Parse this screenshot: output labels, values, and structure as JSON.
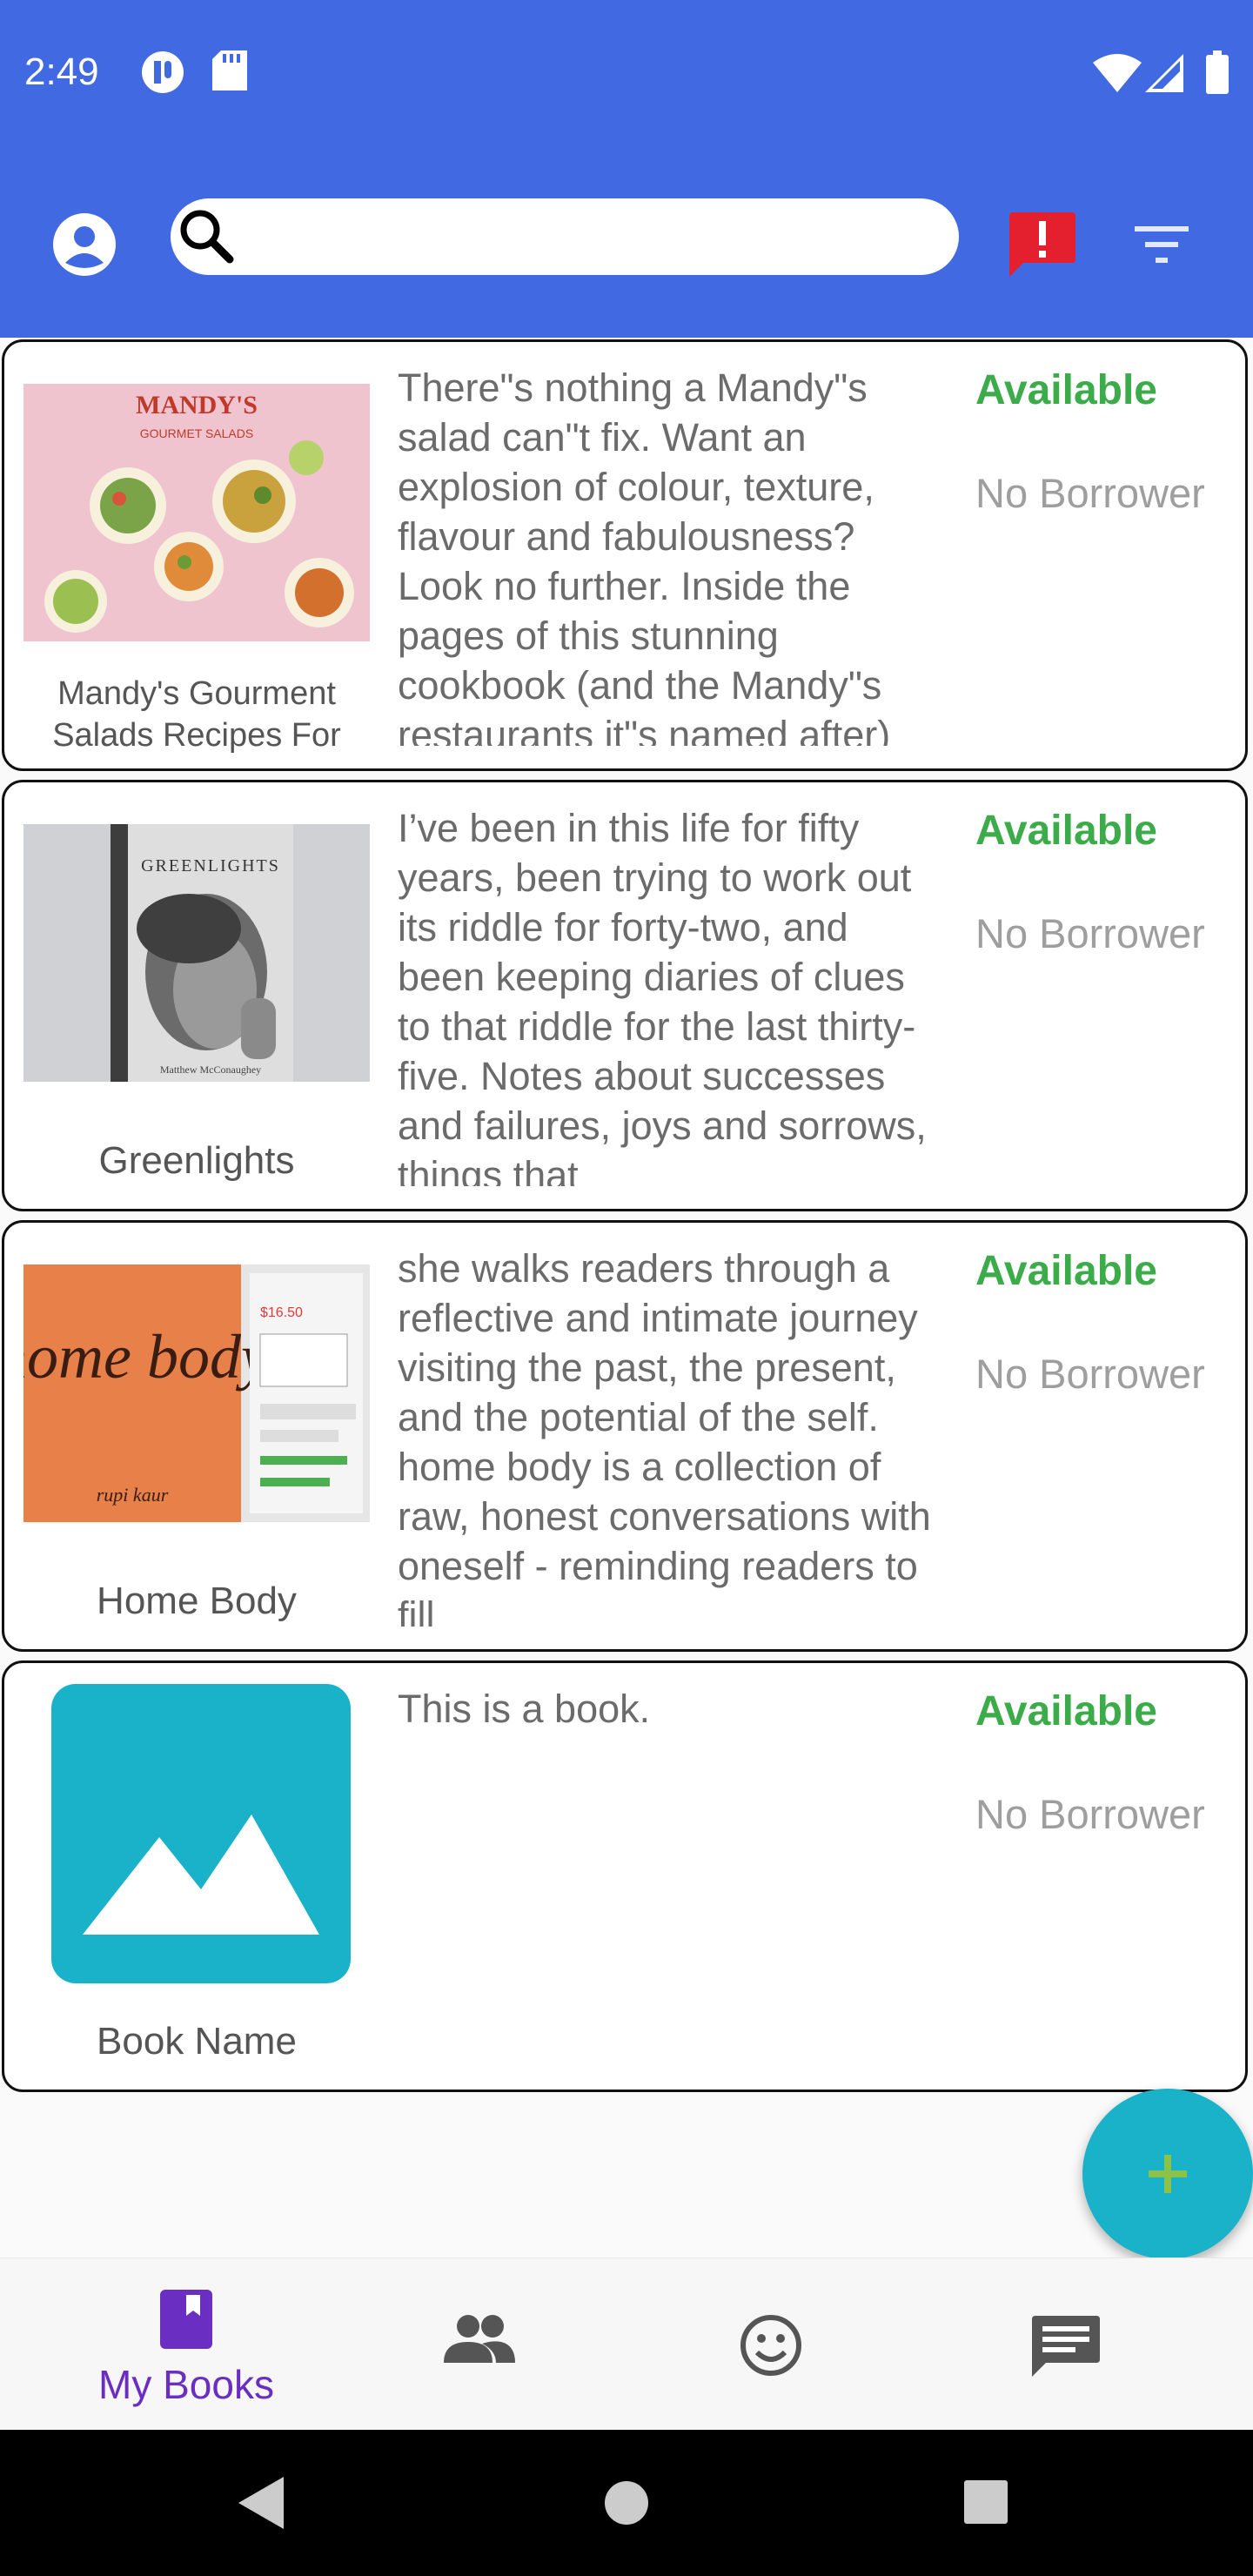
{
  "status_bar": {
    "time": "2:49"
  },
  "search": {
    "value": "",
    "placeholder": ""
  },
  "books": [
    {
      "title": "Mandy's Gourment Salads Recipes For",
      "description": "There\"s nothing a Mandy\"s salad can\"t fix. Want an explosion of colour, texture, flavour and fabulousness? Look no further. Inside the pages of this stunning cookbook (and the Mandy\"s restaurants it\"s named after)",
      "status": "Available",
      "borrower": "No Borrower",
      "cover": {
        "label": "MANDY'S",
        "sublabel": "GOURMET SALADS"
      }
    },
    {
      "title": "Greenlights",
      "description": "I’ve been in this life for fifty years, been trying to work out its riddle for forty-two, and been keeping diaries of clues to that riddle for the last thirty-five. Notes about successes and failures, joys and sorrows, things that",
      "status": "Available",
      "borrower": "No Borrower",
      "cover": {
        "label": "GREENLIGHTS",
        "sublabel": "Matthew McConaughey"
      }
    },
    {
      "title": "Home Body",
      "description": "she walks readers through a reflective and intimate journey visiting the past, the present, and the potential of the self. home body is a collection of raw, honest conversations with oneself - reminding readers to fill",
      "status": "Available",
      "borrower": "No Borrower",
      "cover": {
        "label": "home body",
        "sublabel": "rupi kaur",
        "price": "$16.50"
      }
    },
    {
      "title": "Book Name",
      "description": "This is a book.",
      "status": "Available",
      "borrower": "No Borrower",
      "cover": {
        "label": "",
        "sublabel": ""
      }
    }
  ],
  "bottom_nav": [
    {
      "label": "My Books",
      "icon": "book-icon",
      "active": true
    },
    {
      "label": "",
      "icon": "people-icon",
      "active": false
    },
    {
      "label": "",
      "icon": "smiley-icon",
      "active": false
    },
    {
      "label": "",
      "icon": "chat-icon",
      "active": false
    }
  ],
  "colors": {
    "primary": "#4169e1",
    "available": "#3cab4a",
    "fab": "#19b2c9",
    "fab_plus": "#8bc34a",
    "nav_active": "#6a2fc2",
    "alert": "#e5202e"
  }
}
